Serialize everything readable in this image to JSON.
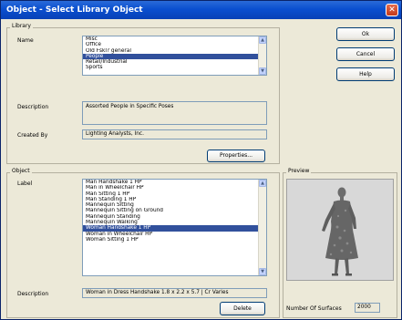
{
  "window": {
    "title": "Object - Select Library Object",
    "close_glyph": "✕"
  },
  "library": {
    "group_title": "Library",
    "name_label": "Name",
    "name_items": [
      "Misc",
      "Office",
      "Old Fskl? general",
      "People",
      "Retail/Industrial",
      "Sports"
    ],
    "name_selected_index": 3,
    "description_label": "Description",
    "description_value": "Assorted People in Specific Poses",
    "created_by_label": "Created By",
    "created_by_value": "Lighting Analysts, Inc.",
    "properties_button": "Properties..."
  },
  "object": {
    "group_title": "Object",
    "label_label": "Label",
    "label_items": [
      "Man Handshake 1 HP",
      "Man in Wheelchair HP",
      "Man Sitting 1 HP",
      "Man Standing 1 HP",
      "Mannequin Sitting",
      "Mannequin Sitting on Ground",
      "Mannequin Standing",
      "Mannequin Walking",
      "Woman Handshake 1 HP",
      "Woman in Wheelchair HP",
      "Woman Sitting 1 HP"
    ],
    "label_selected_index": 8,
    "description_label": "Description",
    "description_value": "Woman in Dress Handshake 1.8 x 2.2 x 5.7 | Cr Varies",
    "delete_button": "Delete"
  },
  "preview": {
    "group_title": "Preview",
    "surfaces_label": "Number Of Surfaces",
    "surfaces_value": "2000"
  },
  "buttons": {
    "ok": "Ok",
    "cancel": "Cancel",
    "help": "Help"
  },
  "icons": {
    "scroll_up": "▲",
    "scroll_down": "▼"
  }
}
